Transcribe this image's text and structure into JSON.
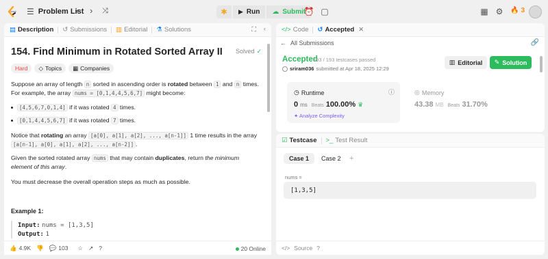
{
  "topbar": {
    "problem_list": "Problem List",
    "run": "Run",
    "submit": "Submit",
    "streak": "3"
  },
  "desc_tabs": {
    "description": "Description",
    "submissions": "Submissions",
    "editorial": "Editorial",
    "solutions": "Solutions"
  },
  "problem": {
    "title": "154. Find Minimum in Rotated Sorted Array II",
    "solved": "Solved",
    "difficulty": "Hard",
    "topics": "Topics",
    "companies": "Companies",
    "p1_a": "Suppose an array of length ",
    "p1_n": "n",
    "p1_b": " sorted in ascending order is ",
    "p1_bold": "rotated",
    "p1_c": " between ",
    "p1_one": "1",
    "p1_d": " and ",
    "p1_n2": "n",
    "p1_e": " times. For example, the array ",
    "p1_nums": "nums = [0,1,4,4,5,6,7]",
    "p1_f": " might become:",
    "bullet1_code": "[4,5,6,7,0,1,4]",
    "bullet1_a": " if it was rotated ",
    "bullet1_k": "4",
    "bullet1_b": " times.",
    "bullet2_code": "[0,1,4,4,5,6,7]",
    "bullet2_a": " if it was rotated ",
    "bullet2_k": "7",
    "bullet2_b": " times.",
    "p2_a": "Notice that ",
    "p2_bold": "rotating",
    "p2_b": " an array ",
    "p2_code1": "[a[0], a[1], a[2], ..., a[n-1]]",
    "p2_c": " 1 time results in the array ",
    "p2_code2": "[a[n-1], a[0], a[1], a[2], ..., a[n-2]]",
    "p2_d": ".",
    "p3_a": "Given the sorted rotated array ",
    "p3_code": "nums",
    "p3_b": " that may contain ",
    "p3_bold": "duplicates",
    "p3_c": ", return ",
    "p3_italic": "the minimum element of this array",
    "p3_d": ".",
    "p4": "You must decrease the overall operation steps as much as possible.",
    "example_title": "Example 1:",
    "input_label": "Input:",
    "input_value": "nums = [1,3,5]",
    "output_label": "Output:",
    "output_value": "1"
  },
  "desc_footer": {
    "likes": "4.9K",
    "comments": "103",
    "online": "20 Online"
  },
  "right_tabs": {
    "code": "Code",
    "accepted": "Accepted"
  },
  "submission": {
    "all_submissions": "All Submissions",
    "status": "Accepted",
    "passed": "193 / 193 testcases passed",
    "user": "sriram036",
    "submitted_at": "submitted at Apr 18, 2025 12:29",
    "editorial_btn": "Editorial",
    "solution_btn": "Solution",
    "runtime_label": "Runtime",
    "runtime_value": "0",
    "runtime_unit": "ms",
    "runtime_beats_label": "Beats",
    "runtime_beats": "100.00%",
    "analyze": "Analyze Complexity",
    "memory_label": "Memory",
    "memory_value": "43.38",
    "memory_unit": "MB",
    "memory_beats_label": "Beats",
    "memory_beats": "31.70%"
  },
  "testcase": {
    "tab_testcase": "Testcase",
    "tab_result": "Test Result",
    "case1": "Case 1",
    "case2": "Case 2",
    "add": "+",
    "nums_label": "nums =",
    "nums_value": "[1,3,5]",
    "source": "Source"
  },
  "colors": {
    "accent_green": "#2cbb5d",
    "hard_red": "#ef4743",
    "streak_orange": "#ff8c1a"
  }
}
